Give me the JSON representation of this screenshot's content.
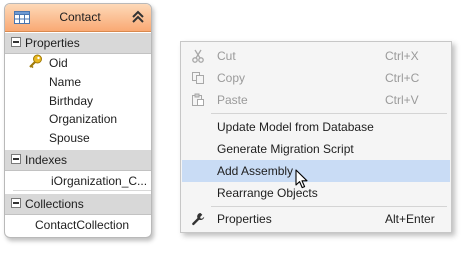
{
  "entity": {
    "title": "Contact",
    "sections": {
      "properties": {
        "label": "Properties",
        "items": [
          "Oid",
          "Name",
          "Birthday",
          "Organization",
          "Spouse"
        ]
      },
      "indexes": {
        "label": "Indexes",
        "items": [
          "iOrganization_C..."
        ]
      },
      "collections": {
        "label": "Collections",
        "items": [
          "ContactCollection"
        ]
      }
    }
  },
  "context_menu": {
    "items": [
      {
        "label": "Cut",
        "shortcut": "Ctrl+X",
        "enabled": false,
        "icon": "scissors-icon"
      },
      {
        "label": "Copy",
        "shortcut": "Ctrl+C",
        "enabled": false,
        "icon": "copy-icon"
      },
      {
        "label": "Paste",
        "shortcut": "Ctrl+V",
        "enabled": false,
        "icon": "paste-icon"
      },
      {
        "label": "Update Model from Database",
        "shortcut": "",
        "enabled": true
      },
      {
        "label": "Generate Migration Script",
        "shortcut": "",
        "enabled": true
      },
      {
        "label": "Add Assembly",
        "shortcut": "",
        "enabled": true,
        "highlighted": true
      },
      {
        "label": "Rearrange Objects",
        "shortcut": "",
        "enabled": true
      },
      {
        "label": "Properties",
        "shortcut": "Alt+Enter",
        "enabled": true,
        "icon": "wrench-icon"
      }
    ]
  },
  "colors": {
    "entity_header": "#f9a974",
    "menu_highlight": "#c9dcf5",
    "section_header": "#d8d8d8"
  }
}
